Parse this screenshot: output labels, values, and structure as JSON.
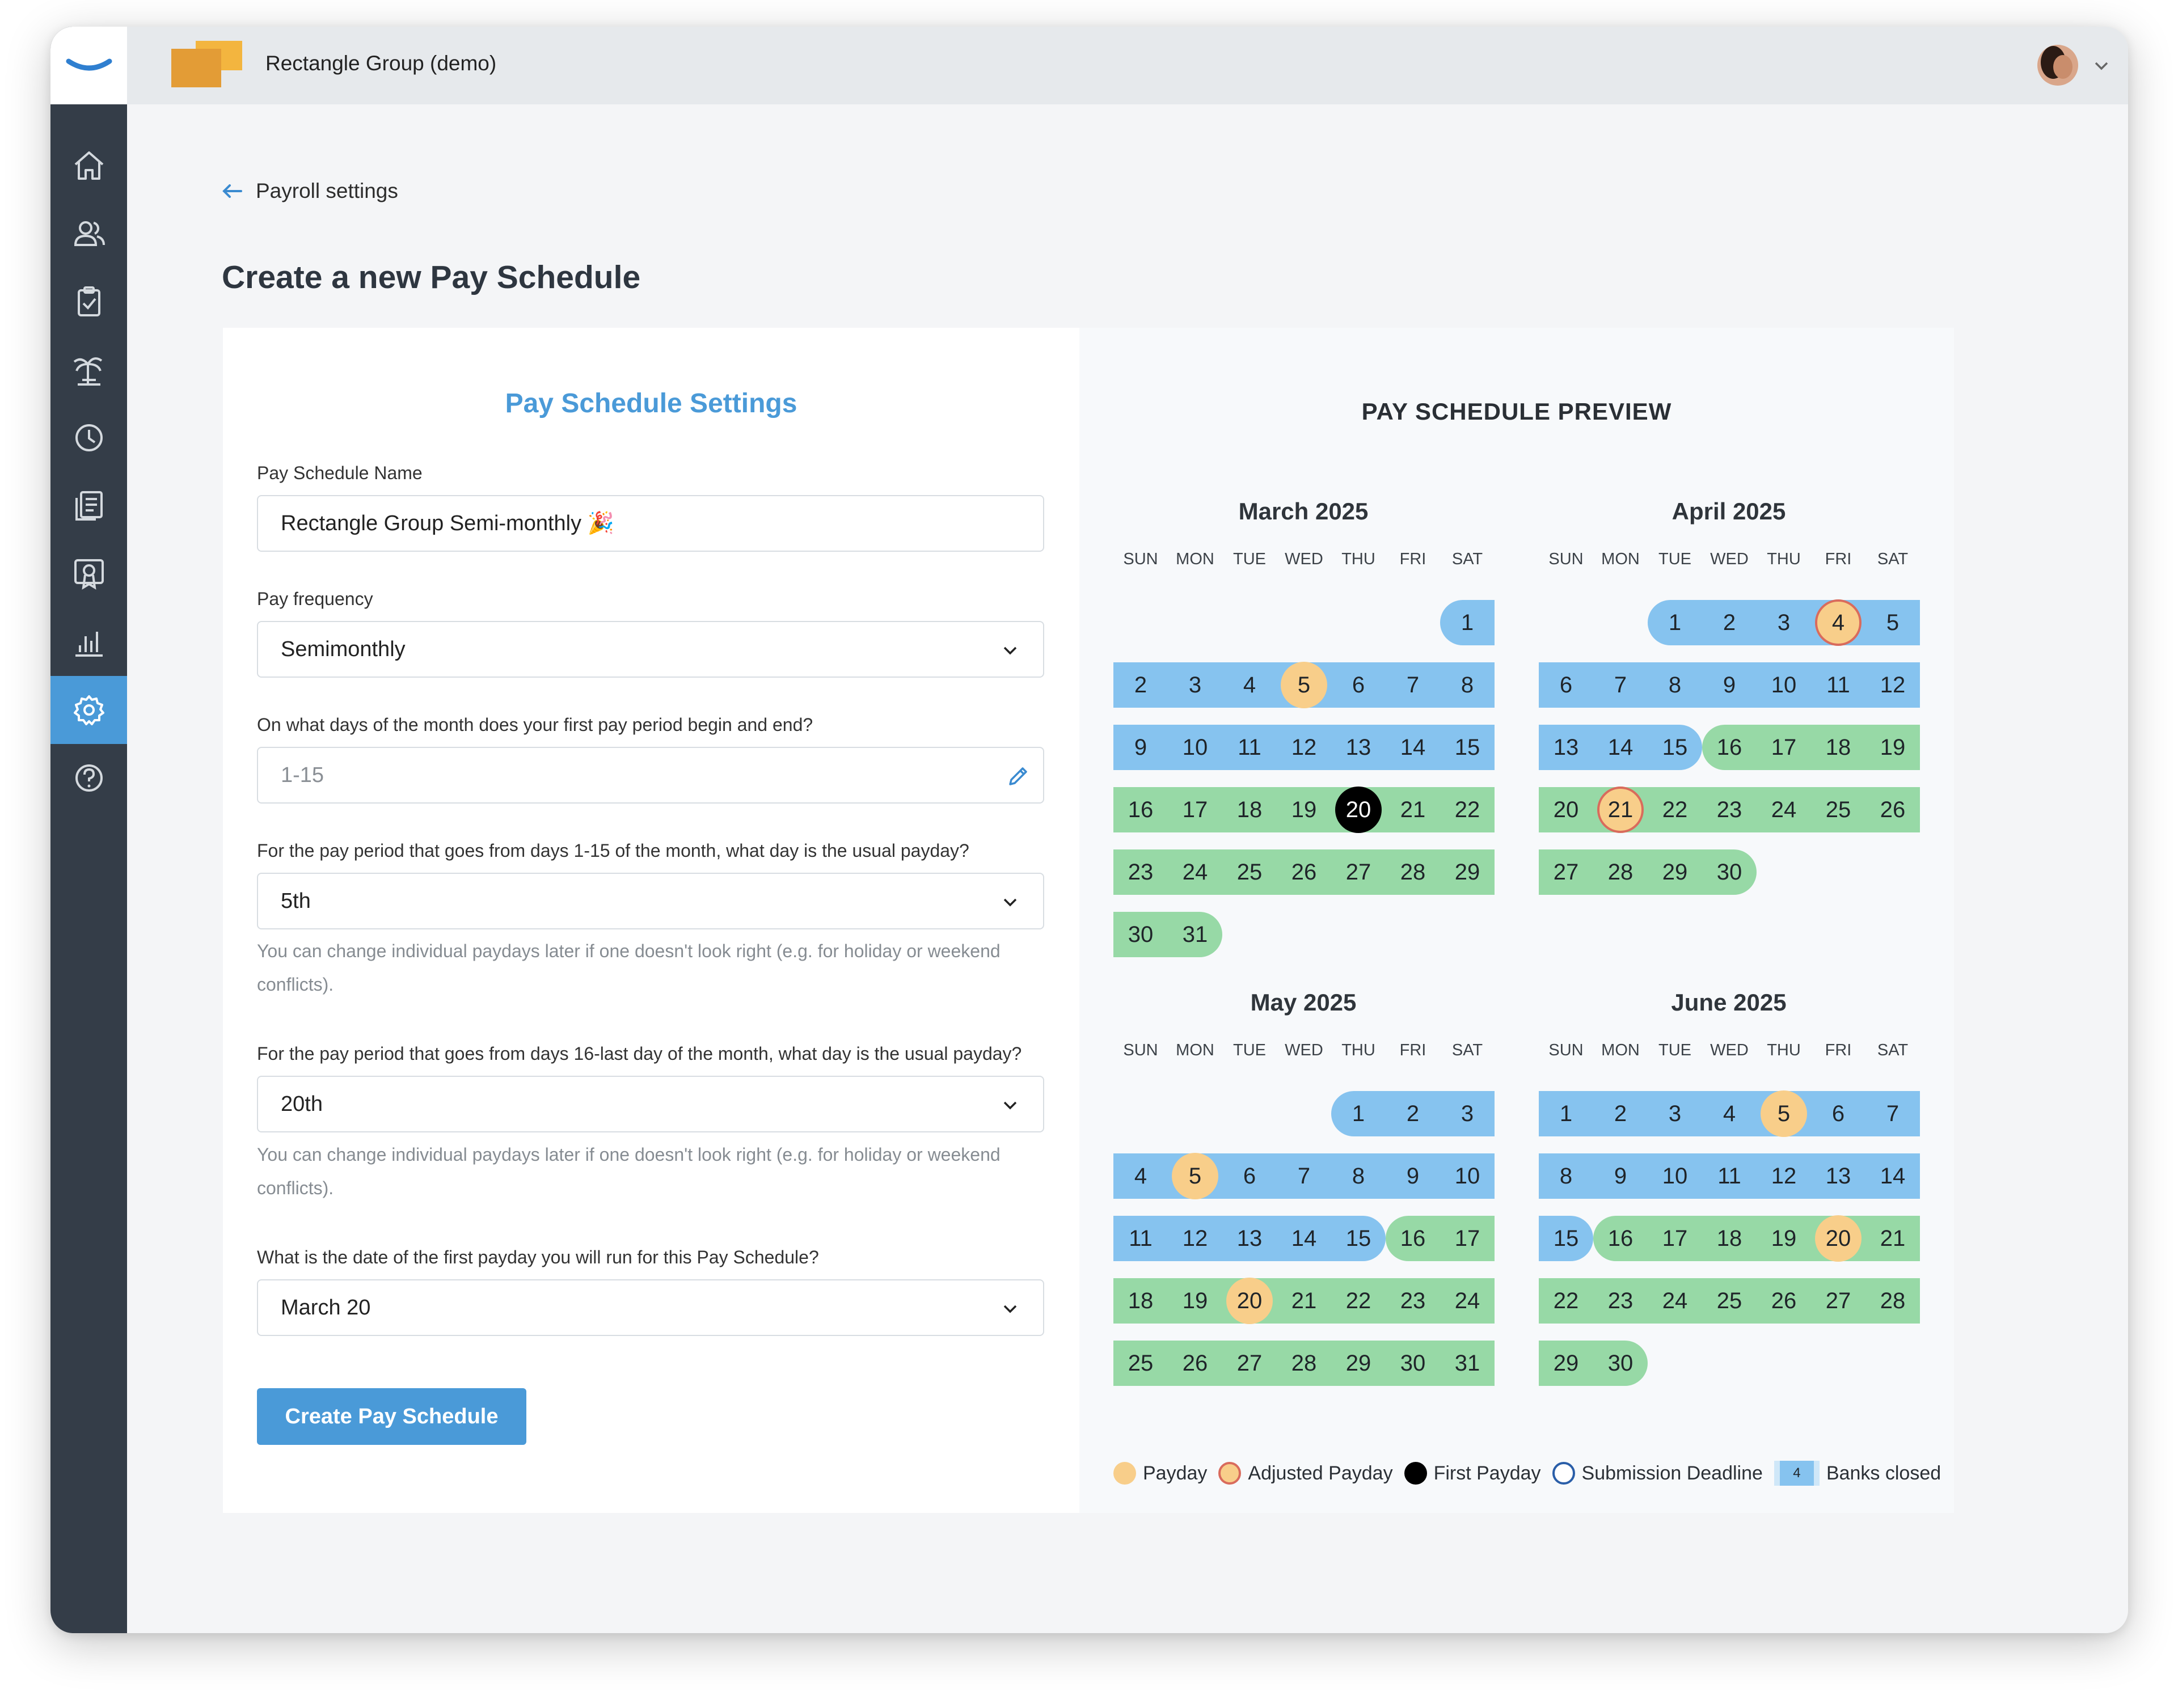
{
  "header": {
    "org_name": "Rectangle Group (demo)"
  },
  "sidebar": {
    "items": [
      {
        "name": "home",
        "icon": "home-icon"
      },
      {
        "name": "people",
        "icon": "people-icon"
      },
      {
        "name": "tasks",
        "icon": "clipboard-check-icon"
      },
      {
        "name": "time-off",
        "icon": "palm-tree-icon"
      },
      {
        "name": "time",
        "icon": "clock-icon"
      },
      {
        "name": "documents",
        "icon": "documents-icon"
      },
      {
        "name": "benefits",
        "icon": "award-icon"
      },
      {
        "name": "reports",
        "icon": "bar-chart-icon"
      },
      {
        "name": "settings",
        "icon": "gear-icon",
        "active": true
      },
      {
        "name": "help",
        "icon": "help-icon"
      }
    ],
    "accent": "#4a9ad8"
  },
  "nav": {
    "back_label": "Payroll settings"
  },
  "page": {
    "title": "Create a new Pay Schedule"
  },
  "form": {
    "title": "Pay Schedule Settings",
    "name_label": "Pay Schedule Name",
    "name_value": "Rectangle Group Semi-monthly 🎉",
    "frequency_label": "Pay frequency",
    "frequency_value": "Semimonthly",
    "period_label": "On what days of the month does your first pay period begin and end?",
    "period_placeholder": "1-15",
    "payday1_label": "For the pay period that goes from days 1-15 of the month, what day is the usual payday?",
    "payday1_value": "5th",
    "payday1_hint": "You can change individual paydays later if one doesn't look right (e.g. for holiday or weekend conflicts).",
    "payday2_label": "For the pay period that goes from days 16-last day of the month, what day is the usual payday?",
    "payday2_value": "20th",
    "payday2_hint": "You can change individual paydays later if one doesn't look right (e.g. for holiday or weekend conflicts).",
    "first_payday_label": "What is the date of the first payday you will run for this Pay Schedule?",
    "first_payday_value": "March 20",
    "submit_label": "Create Pay Schedule"
  },
  "preview": {
    "title": "PAY SCHEDULE PREVIEW",
    "weekdays": [
      "SUN",
      "MON",
      "TUE",
      "WED",
      "THU",
      "FRI",
      "SAT"
    ],
    "colors": {
      "period_a": "#86c3ef",
      "period_b": "#97d9a6",
      "payday": "#f8ce8a",
      "adjusted_border": "#d96b5c",
      "first": "#000000"
    },
    "months": [
      {
        "title": "March 2025",
        "first_weekday": 6,
        "days": 31,
        "split": 15,
        "paydays": [
          5
        ],
        "adjusted": [],
        "first_payday": [
          20
        ]
      },
      {
        "title": "April 2025",
        "first_weekday": 2,
        "days": 30,
        "split": 15,
        "paydays": [],
        "adjusted": [
          4,
          21
        ],
        "first_payday": []
      },
      {
        "title": "May 2025",
        "first_weekday": 4,
        "days": 31,
        "split": 15,
        "paydays": [
          5,
          20
        ],
        "adjusted": [],
        "first_payday": []
      },
      {
        "title": "June 2025",
        "first_weekday": 0,
        "days": 30,
        "split": 15,
        "paydays": [
          5,
          20
        ],
        "adjusted": [],
        "first_payday": []
      }
    ],
    "legend": {
      "payday": "Payday",
      "adjusted": "Adjusted Payday",
      "first": "First Payday",
      "submission": "Submission Deadline",
      "banks_sample": "4",
      "banks": "Banks closed"
    }
  }
}
